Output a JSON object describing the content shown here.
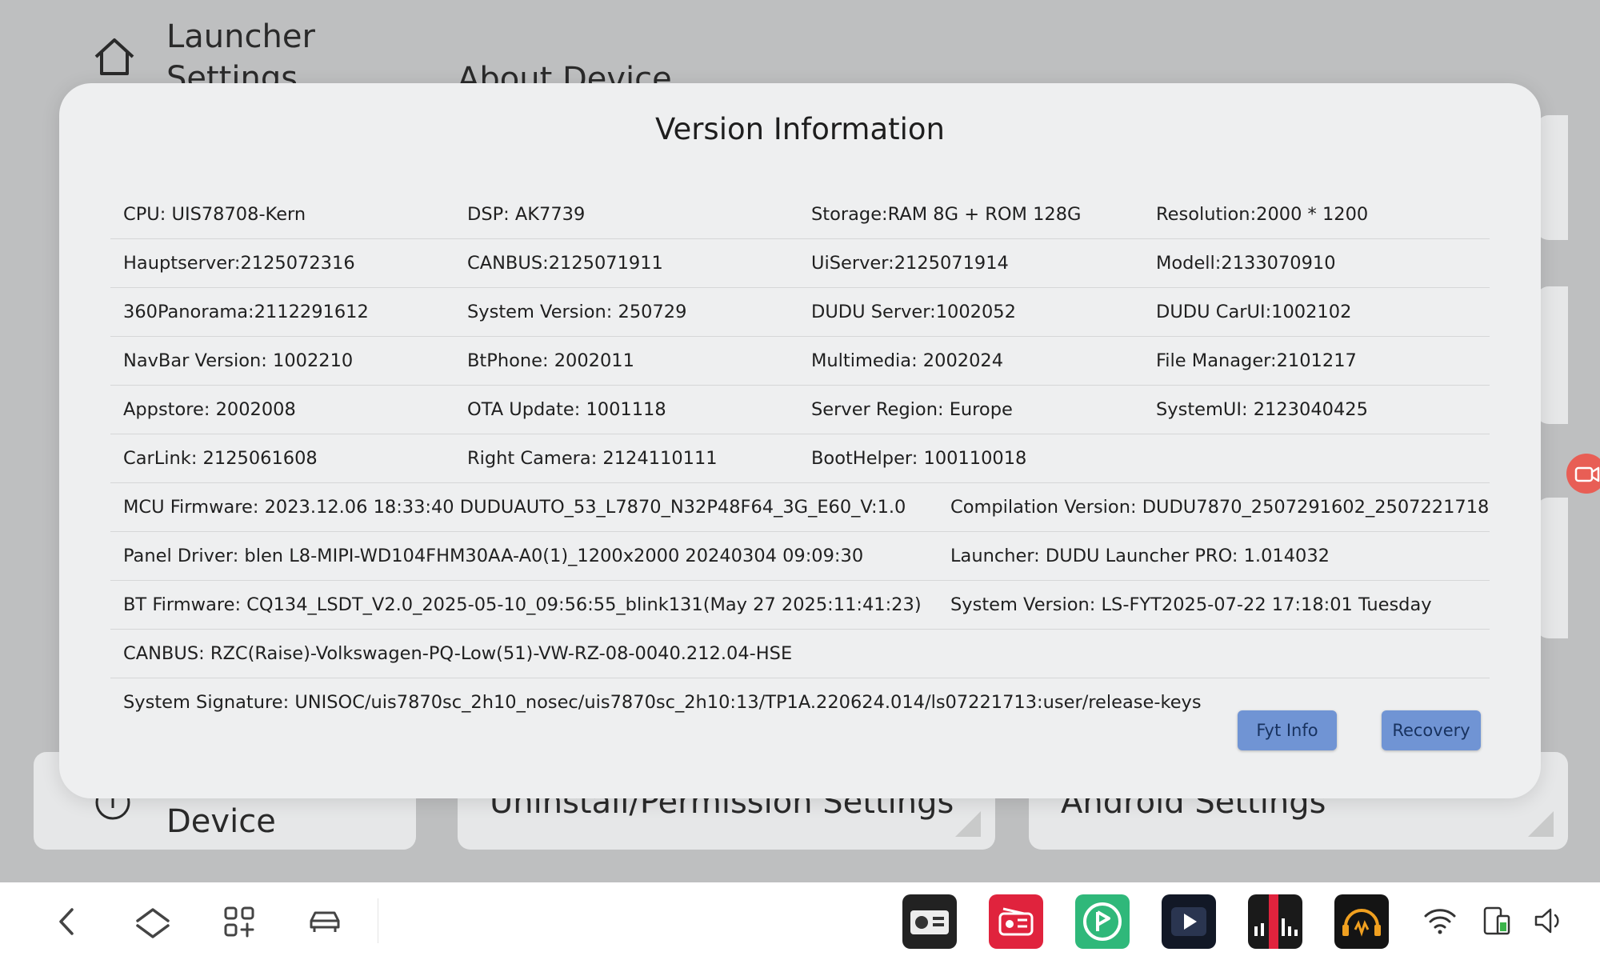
{
  "background": {
    "header_title": "Launcher Settings",
    "about_title": "About Device",
    "cards": [
      {
        "label": "Device"
      },
      {
        "label": "Uninstall/Permission Settings"
      },
      {
        "label": "Android Settings"
      }
    ]
  },
  "dialog": {
    "title": "Version Information",
    "rows4": [
      [
        "CPU:  UIS78708-Kern",
        "DSP:  AK7739",
        "Storage:RAM 8G + ROM 128G",
        "Resolution:2000 * 1200"
      ],
      [
        "Hauptserver:2125072316",
        "CANBUS:2125071911",
        "UiServer:2125071914",
        "Modell:2133070910"
      ],
      [
        "360Panorama:2112291612",
        "System Version:  250729",
        "DUDU Server:1002052",
        "DUDU CarUI:1002102"
      ],
      [
        "NavBar Version:  1002210",
        "BtPhone:   2002011",
        "Multimedia:   2002024",
        "File Manager:2101217"
      ],
      [
        "Appstore:   2002008",
        "OTA Update:   1001118",
        "Server Region:  Europe",
        "SystemUI:   2123040425"
      ],
      [
        "CarLink:   2125061608",
        "Right Camera:   2124110111",
        "BootHelper: 100110018",
        ""
      ]
    ],
    "rows2": [
      [
        "MCU Firmware:  2023.12.06 18:33:40 DUDUAUTO_53_L7870_N32P48F64_3G_E60_V:1.0",
        "Compilation Version:  DUDU7870_2507291602_2507221718"
      ],
      [
        "Panel Driver:  blen L8-MIPI-WD104FHM30AA-A0(1)_1200x2000 20240304 09:09:30",
        "Launcher:  DUDU Launcher PRO: 1.014032"
      ],
      [
        "BT Firmware:  CQ134_LSDT_V2.0_2025-05-10_09:56:55_blink131(May 27 2025:11:41:23)",
        "System Version:  LS-FYT2025-07-22 17:18:01 Tuesday"
      ]
    ],
    "rows1": [
      "CANBUS:  RZC(Raise)-Volkswagen-PQ-Low(51)-VW-RZ-08-0040.212.04-HSE",
      "System Signature:  UNISOC/uis7870sc_2h10_nosec/uis7870sc_2h10:13/TP1A.220624.014/ls07221713:user/release-keys"
    ],
    "buttons": {
      "fyt_info": "Fyt Info",
      "recovery": "Recovery"
    }
  },
  "colors": {
    "button_bg": "#7094d4",
    "dialog_bg": "#eeeff0",
    "backdrop": "#bebfc0",
    "camera_bubble": "#e85e55"
  },
  "navbar": {
    "icons": [
      "back-icon",
      "home-icon",
      "apps-icon",
      "car-icon"
    ],
    "apps": [
      "radio-app-icon",
      "fm-radio-app-icon",
      "music-app-icon",
      "video-player-app-icon",
      "equalizer-app-icon",
      "audio-app-icon"
    ],
    "status": [
      "wifi-icon",
      "phone-battery-icon",
      "volume-icon"
    ]
  }
}
